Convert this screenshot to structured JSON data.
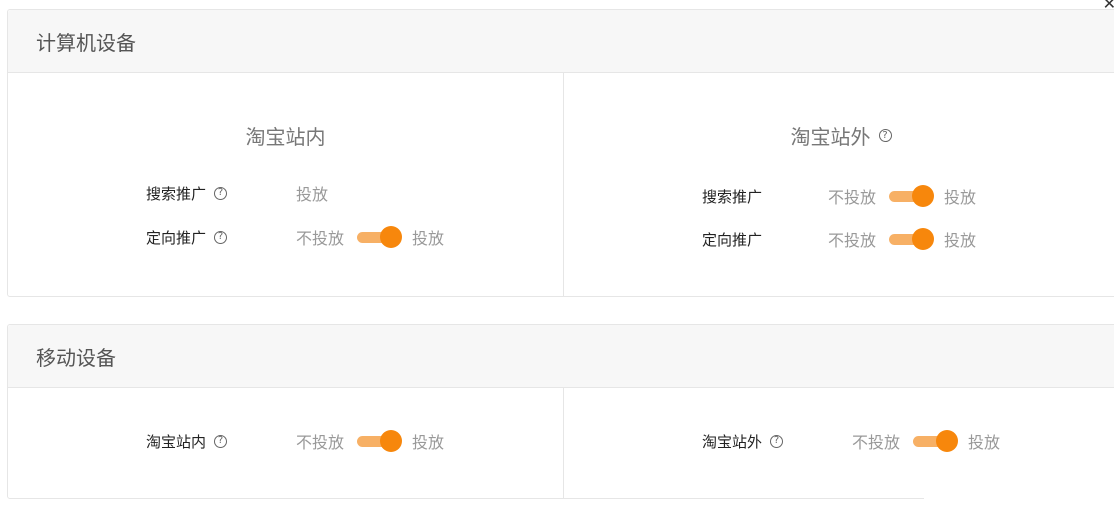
{
  "computer_section": {
    "title": "计算机设备",
    "left": {
      "title": "淘宝站内",
      "rows": [
        {
          "label": "搜索推广",
          "on_label": "投放"
        },
        {
          "label": "定向推广",
          "off_label": "不投放",
          "on_label": "投放",
          "enabled": true
        }
      ]
    },
    "right": {
      "title": "淘宝站外",
      "rows": [
        {
          "label": "搜索推广",
          "off_label": "不投放",
          "on_label": "投放",
          "enabled": true
        },
        {
          "label": "定向推广",
          "off_label": "不投放",
          "on_label": "投放",
          "enabled": true
        }
      ]
    }
  },
  "mobile_section": {
    "title": "移动设备",
    "left": {
      "label": "淘宝站内",
      "off_label": "不投放",
      "on_label": "投放",
      "enabled": true
    },
    "right": {
      "label": "淘宝站外",
      "off_label": "不投放",
      "on_label": "投放",
      "enabled": true
    }
  },
  "icons": {
    "help": "question-circle-icon",
    "corner": "close-icon"
  },
  "colors": {
    "toggle_knob": "#f7870c",
    "toggle_track": "#f7b065"
  }
}
